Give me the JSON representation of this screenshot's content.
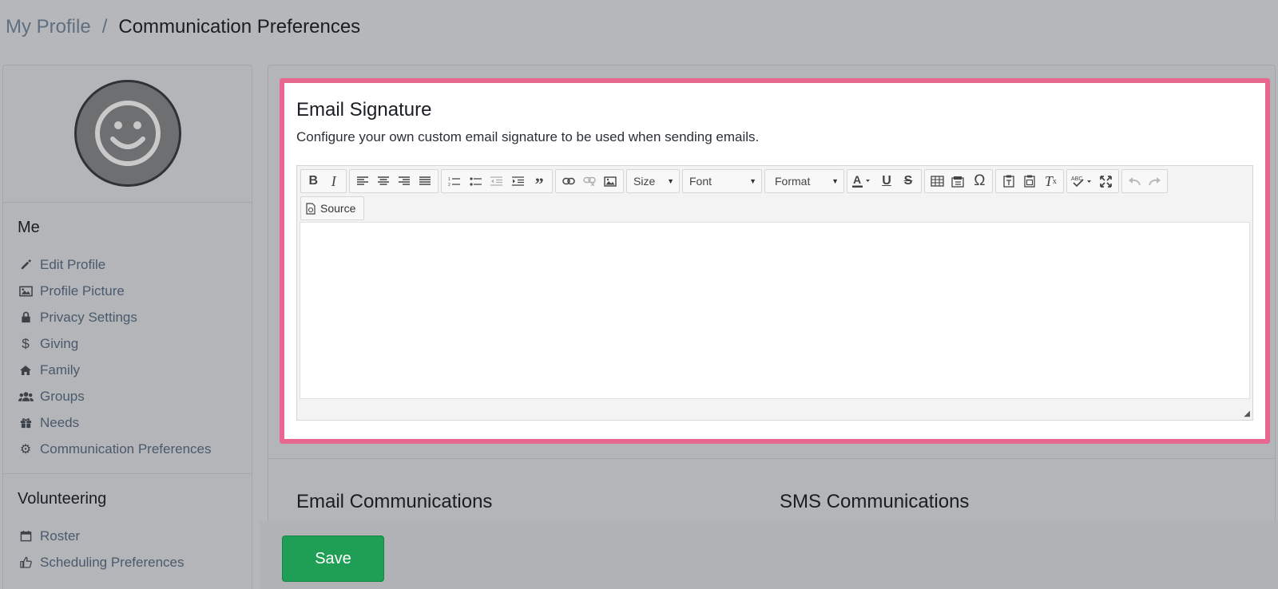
{
  "breadcrumb": {
    "parent": "My Profile",
    "separator": "/",
    "current": "Communication Preferences"
  },
  "sidebar": {
    "me_heading": "Me",
    "me_items": [
      {
        "label": "Edit Profile",
        "icon": "pencil-icon"
      },
      {
        "label": "Profile Picture",
        "icon": "image-icon"
      },
      {
        "label": "Privacy Settings",
        "icon": "lock-icon"
      },
      {
        "label": "Giving",
        "icon": "dollar-icon"
      },
      {
        "label": "Family",
        "icon": "home-icon"
      },
      {
        "label": "Groups",
        "icon": "users-icon"
      },
      {
        "label": "Needs",
        "icon": "gift-icon"
      },
      {
        "label": "Communication Preferences",
        "icon": "gear-icon"
      }
    ],
    "volunteer_heading": "Volunteering",
    "volunteer_items": [
      {
        "label": "Roster",
        "icon": "calendar-icon"
      },
      {
        "label": "Scheduling Preferences",
        "icon": "thumbs-up-icon"
      }
    ]
  },
  "signature": {
    "title": "Email Signature",
    "description": "Configure your own custom email signature to be used when sending emails.",
    "toolbar": {
      "size_label": "Size",
      "font_label": "Font",
      "format_label": "Format",
      "source_label": "Source"
    },
    "content": ""
  },
  "communications": {
    "email_title": "Email Communications",
    "sms_title": "SMS Communications"
  },
  "footer": {
    "save_label": "Save"
  },
  "colors": {
    "highlight_border": "#e8678f",
    "save_button": "#1f9e55"
  }
}
